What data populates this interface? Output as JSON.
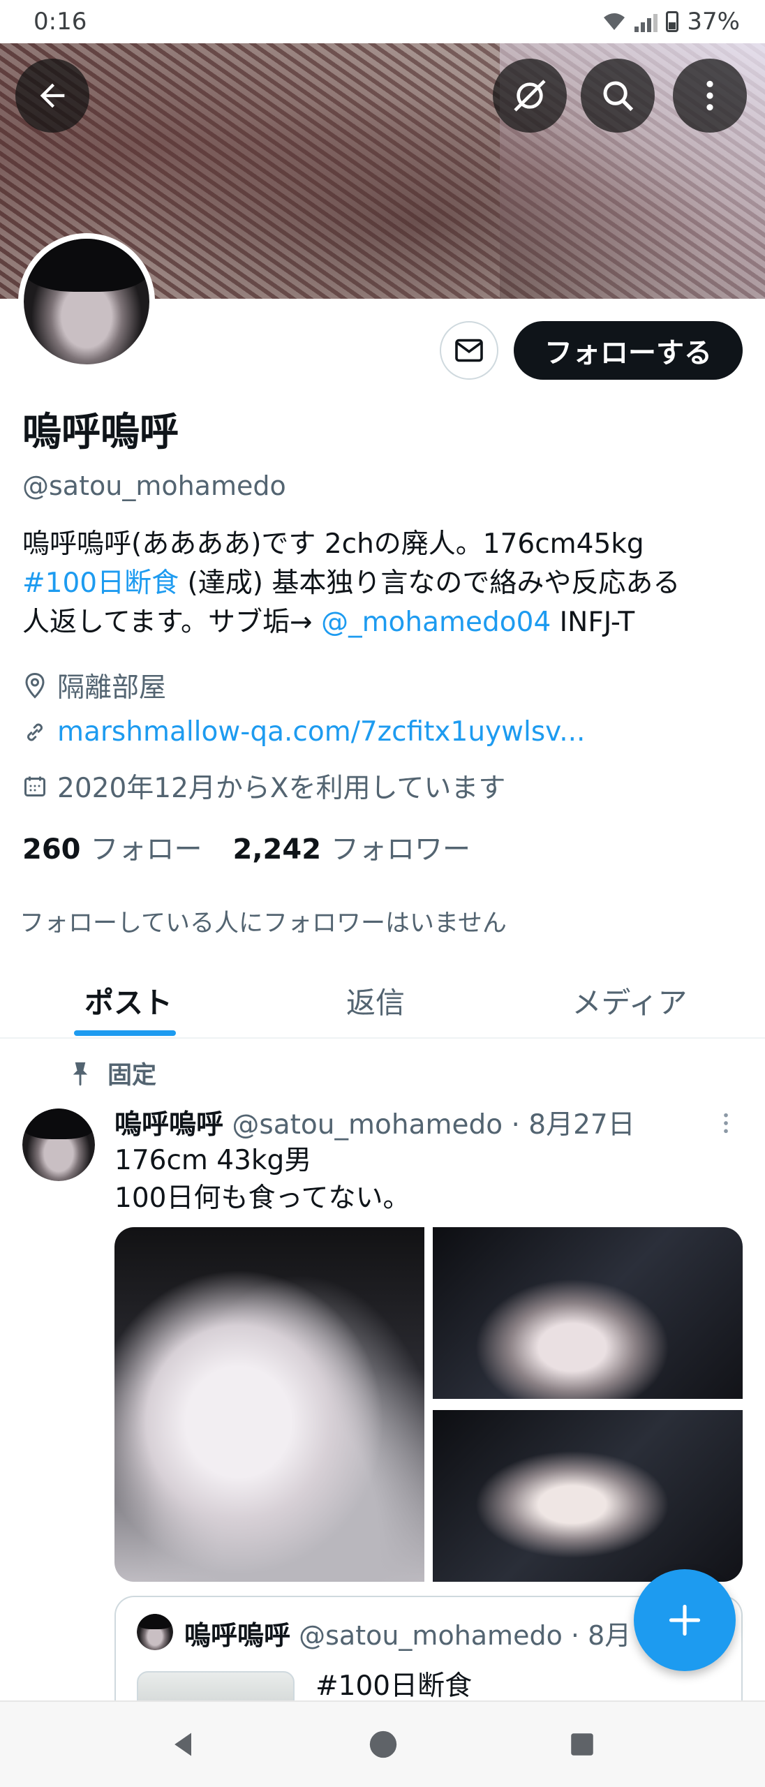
{
  "status_bar": {
    "time": "0:16",
    "battery": "37%"
  },
  "header": {
    "icons": [
      "back-arrow-icon",
      "grok-icon",
      "search-icon",
      "more-vertical-icon"
    ]
  },
  "profile": {
    "follow_button": "フォローする",
    "display_name": "嗚呼嗚呼",
    "handle": "@satou_mohamedo",
    "bio": {
      "line1": "嗚呼嗚呼(ああああ)です 2chの廃人。176cm45kg",
      "hashtag": "#100日断食",
      "line2_rest": " (達成) 基本独り言なので絡みや反応ある",
      "line3_prefix": "人返してます。サブ垢→ ",
      "mention": "@_mohamedo04",
      "line3_suffix": " INFJ-T"
    },
    "location": "隔離部屋",
    "website": "marshmallow-qa.com/7zcfitx1uywlsv...",
    "joined": "2020年12月からXを利用しています",
    "following_count": "260",
    "following_label": "フォロー",
    "followers_count": "2,242",
    "followers_label": "フォロワー",
    "no_mutual_followers": "フォローしている人にフォロワーはいません"
  },
  "tabs": [
    {
      "label": "ポスト",
      "active": true
    },
    {
      "label": "返信",
      "active": false
    },
    {
      "label": "メディア",
      "active": false
    }
  ],
  "pinned_post": {
    "pinned_label": "固定",
    "author_name": "嗚呼嗚呼",
    "author_meta": "@satou_mohamedo · 8月27日",
    "text_line1": "176cm 43kg男",
    "text_line2": "100日何も食ってない。",
    "quote": {
      "author_name": "嗚呼嗚呼",
      "author_meta": "@satou_mohamedo · 8月",
      "text": "#100日断食"
    }
  },
  "colors": {
    "accent": "#1d9bf0",
    "text": "#0f1419",
    "secondary": "#536471"
  }
}
